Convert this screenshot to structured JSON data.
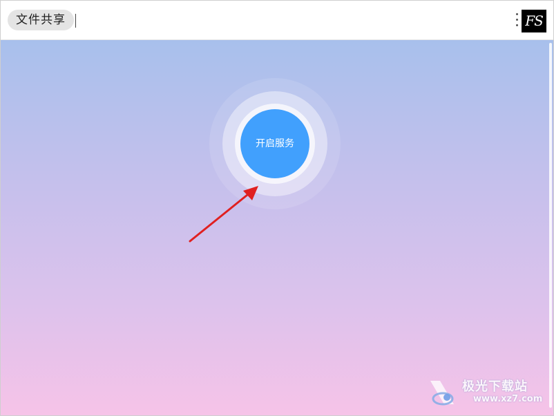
{
  "header": {
    "title": "文件共享",
    "menu_icon": "kebab-menu-icon",
    "logo_text": "FS"
  },
  "main": {
    "start_service_label": "开启服务"
  },
  "annotation": {
    "arrow_color": "#e02020"
  },
  "watermark": {
    "title": "极光下载站",
    "url": "www.xz7.com"
  },
  "colors": {
    "button": "#41a0fd",
    "gradient_top": "#a8c0ec",
    "gradient_bottom": "#f6c3e8"
  }
}
